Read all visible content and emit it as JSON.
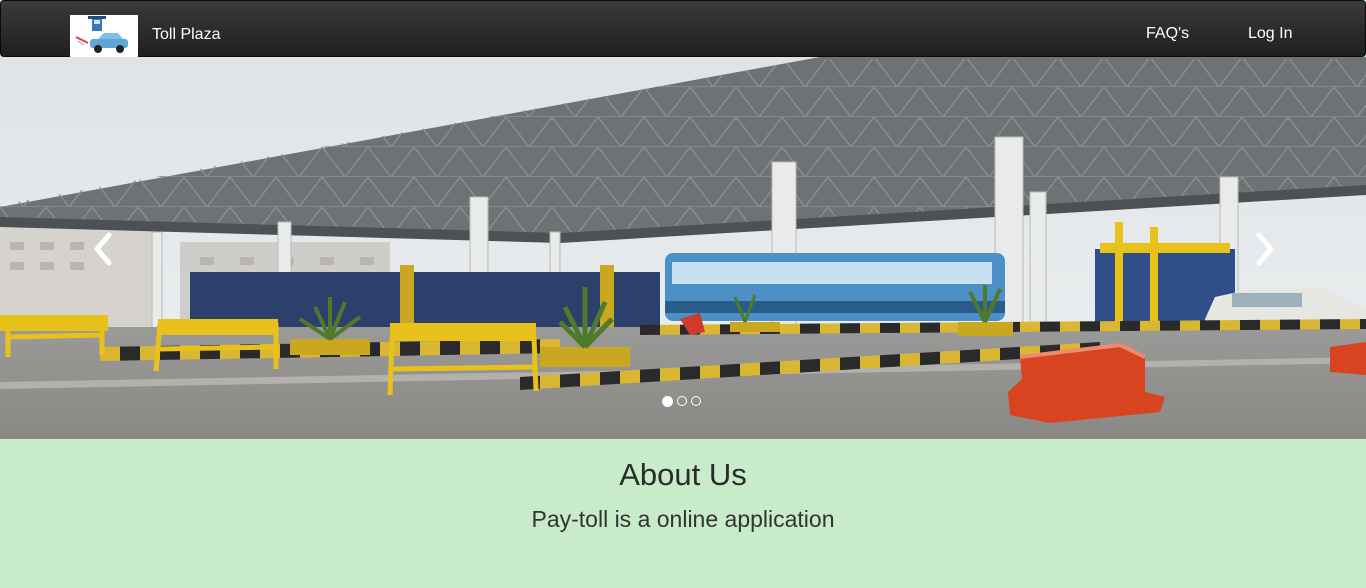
{
  "navbar": {
    "brand": "Toll Plaza",
    "links": {
      "faq": "FAQ's",
      "login": "Log In"
    },
    "logo_icon": "toll-booth-car-icon"
  },
  "carousel": {
    "slide_count": 3,
    "active_index": 0,
    "prev_icon": "chevron-left-icon",
    "next_icon": "chevron-right-icon"
  },
  "about": {
    "heading": "About Us",
    "text": "Pay-toll is a online application"
  },
  "colors": {
    "navbar_bg": "#222222",
    "page_bg": "#c8ebca",
    "accent_yellow": "#e8c21a",
    "barrier_red": "#d8441f"
  }
}
